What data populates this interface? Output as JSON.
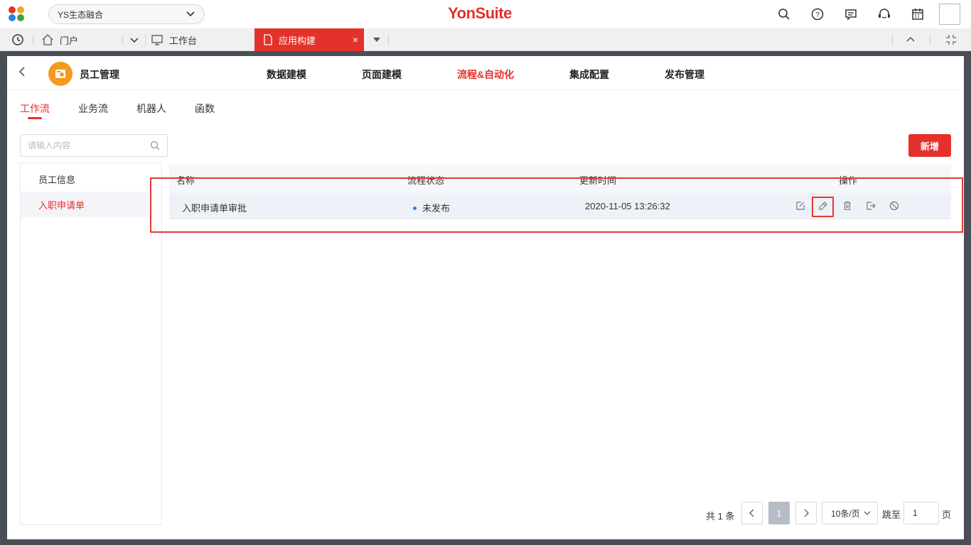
{
  "header": {
    "tenant": "YS生态融合",
    "brand_yon": "Yon",
    "brand_suite": "Suite",
    "icons": [
      "search-icon",
      "help-icon",
      "message-icon",
      "service-icon",
      "calendar-icon",
      "avatar"
    ]
  },
  "tabbar": {
    "history_icon": "history-icon",
    "portal_label": "门户",
    "workbench_label": "工作台",
    "active_tab_label": "应用构建",
    "close_symbol": "×"
  },
  "app": {
    "name": "员工管理",
    "nav": [
      {
        "label": "数据建模",
        "active": false
      },
      {
        "label": "页面建模",
        "active": false
      },
      {
        "label": "流程&自动化",
        "active": true
      },
      {
        "label": "集成配置",
        "active": false
      },
      {
        "label": "发布管理",
        "active": false
      }
    ]
  },
  "subtabs": [
    {
      "label": "工作流",
      "active": true
    },
    {
      "label": "业务流",
      "active": false
    },
    {
      "label": "机器人",
      "active": false
    },
    {
      "label": "函数",
      "active": false
    }
  ],
  "search": {
    "placeholder": "请输入内容"
  },
  "left_list": [
    {
      "label": "员工信息",
      "active": false
    },
    {
      "label": "入职申请单",
      "active": true
    }
  ],
  "add_button": "新增",
  "table": {
    "headers": [
      "名称",
      "流程状态",
      "更新时间",
      "操作"
    ],
    "rows": [
      {
        "name": "入职申请单审批",
        "status": "未发布",
        "updated": "2020-11-05 13:26:32"
      }
    ],
    "operations": [
      "edit-icon",
      "design-icon",
      "delete-icon",
      "export-icon",
      "disable-icon"
    ]
  },
  "pagination": {
    "total": "共 1 条",
    "current": "1",
    "page_size": "10条/页",
    "jump_label": "跳至",
    "jump_value": "1",
    "page_suffix": "页"
  },
  "colors": {
    "accent": "#e4312b",
    "status_dot": "#1e88e5",
    "highlight": "#e53935"
  }
}
